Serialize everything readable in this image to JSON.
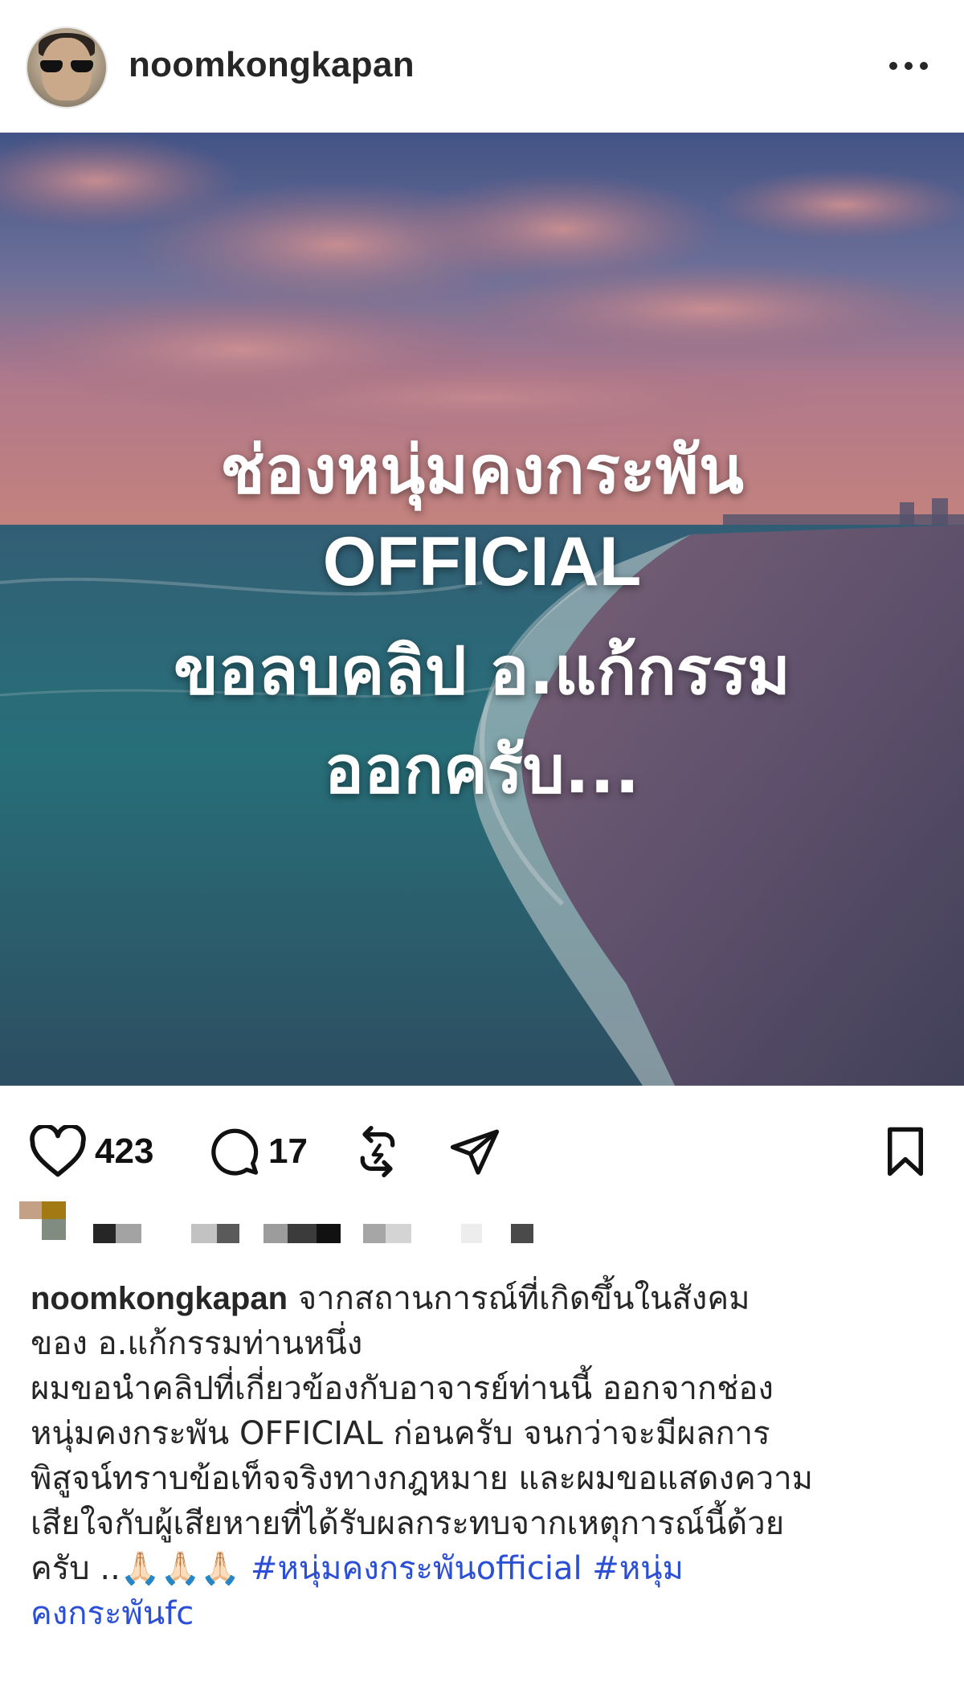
{
  "header": {
    "username": "noomkongkapan"
  },
  "post": {
    "overlay_lines": [
      "ช่องหนุ่มคงกระพัน",
      "OFFICIAL",
      "ขอลบคลิป อ.แก้กรรม",
      "ออกครับ..."
    ]
  },
  "actions": {
    "like_count": "423",
    "comment_count": "17",
    "icons": [
      "heart-icon",
      "comment-icon",
      "repost-icon",
      "share-icon",
      "bookmark-icon"
    ]
  },
  "caption": {
    "username": "noomkongkapan",
    "line1_rest": " จากสถานการณ์ที่เกิดขึ้นในสังคม",
    "line2": "ของ อ.แก้กรรมท่านหนึ่ง",
    "line3": "ผมขอนำคลิปที่เกี่ยวข้องกับอาจารย์ท่านนี้ ออกจากช่อง",
    "line4": "หนุ่มคงกระพัน OFFICIAL ก่อนครับ จนกว่าจะมีผลการ",
    "line5": "พิสูจน์ทราบข้อเท็จจริงทางกฎหมาย และผมขอแสดงความ",
    "line6": "เสียใจกับผู้เสียหายที่ได้รับผลกระทบจากเหตุการณ์นี้ด้วย",
    "line7_text": "ครับ ..",
    "line7_emoji": "🙏🏻🙏🏻🙏🏻",
    "hashtag1": "#หนุ่มคงกระพันofficial",
    "hashtag2_part1": "#หนุ่ม",
    "hashtag2_part2": "คงกระพันfc"
  },
  "colors": {
    "hashtag": "#2b4fd6",
    "text": "#262626"
  }
}
